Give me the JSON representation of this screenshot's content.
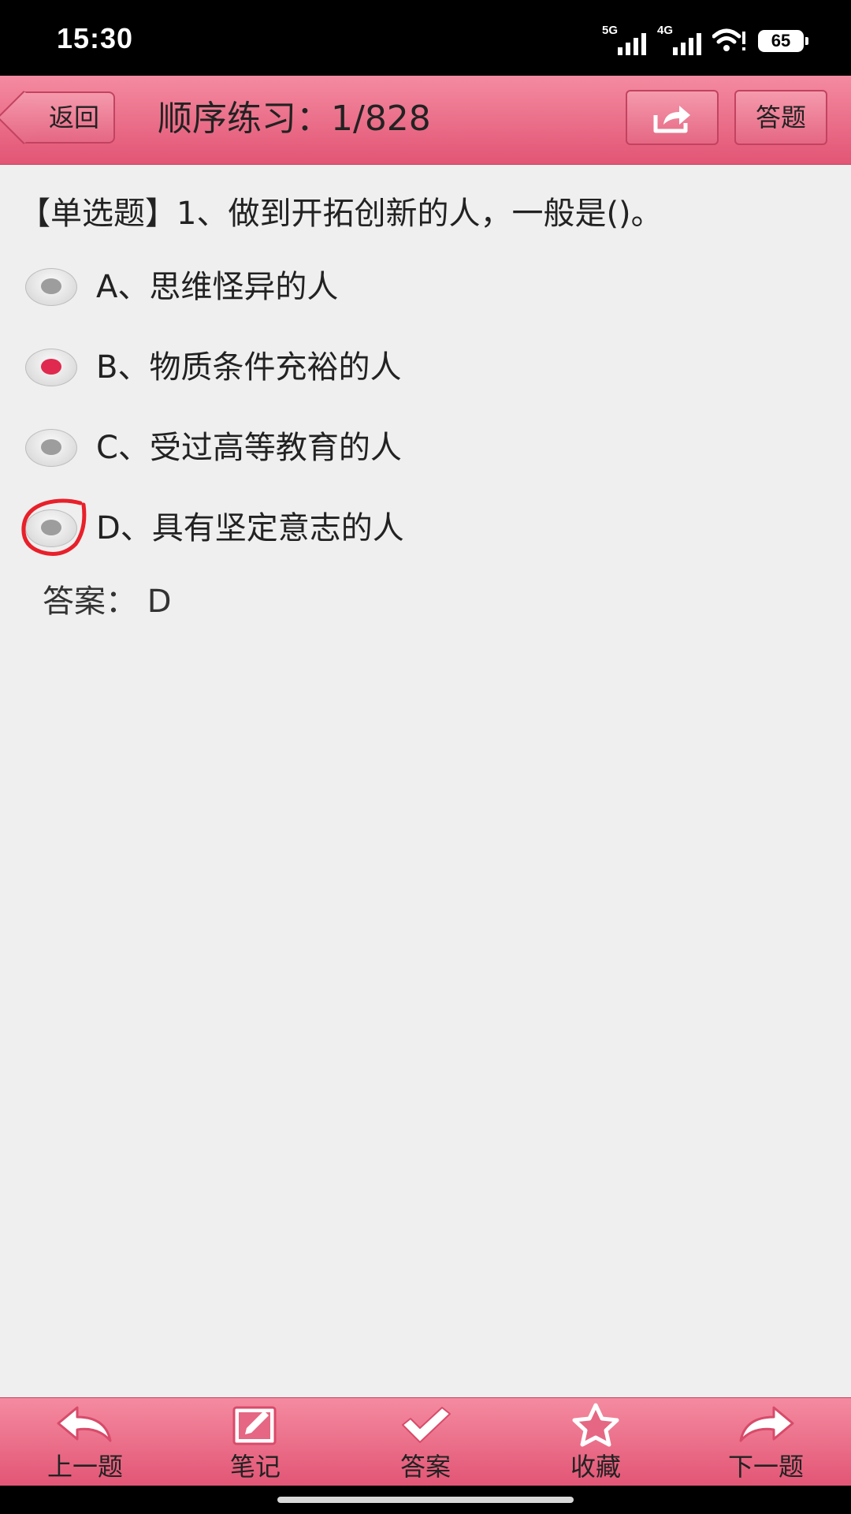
{
  "status_bar": {
    "time": "15:30",
    "network_1": "5G",
    "network_2": "4G",
    "battery": "65"
  },
  "header": {
    "back_label": "返回",
    "title": "顺序练习：1/828",
    "share_icon": "share-icon",
    "answer_label": "答题"
  },
  "question": {
    "text": "【单选题】1、做到开拓创新的人，一般是()。",
    "options": [
      {
        "label": "A、思维怪异的人",
        "selected": false
      },
      {
        "label": "B、物质条件充裕的人",
        "selected": true
      },
      {
        "label": "C、受过高等教育的人",
        "selected": false
      },
      {
        "label": "D、具有坚定意志的人",
        "selected": false
      }
    ],
    "answer_text": "答案：  D",
    "annotation_color": "#e8202a"
  },
  "toolbar": {
    "items": [
      {
        "label": "上一题",
        "icon": "previous-arrow-icon"
      },
      {
        "label": "笔记",
        "icon": "note-edit-icon"
      },
      {
        "label": "答案",
        "icon": "checkmark-icon"
      },
      {
        "label": "收藏",
        "icon": "star-icon"
      },
      {
        "label": "下一题",
        "icon": "next-arrow-icon"
      }
    ]
  },
  "colors": {
    "header_top": "#f48ba0",
    "header_bottom": "#e25575",
    "selected_radio": "#e0294e",
    "background": "#efefef"
  }
}
